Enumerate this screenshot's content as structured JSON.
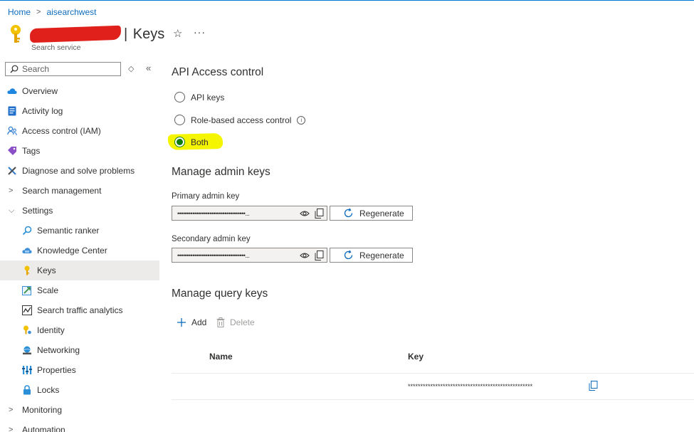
{
  "breadcrumb": {
    "home": "Home",
    "resource": "aisearchwest"
  },
  "header": {
    "title": "Keys",
    "subtitle": "Search service"
  },
  "sidebar": {
    "search_placeholder": "Search",
    "items": [
      {
        "label": "Overview",
        "icon": "cloud-icon"
      },
      {
        "label": "Activity log",
        "icon": "log-icon"
      },
      {
        "label": "Access control (IAM)",
        "icon": "people-icon"
      },
      {
        "label": "Tags",
        "icon": "tag-icon"
      },
      {
        "label": "Diagnose and solve problems",
        "icon": "wrench-icon"
      },
      {
        "label": "Search management",
        "icon": "chevron-right-icon"
      },
      {
        "label": "Settings",
        "icon": "chevron-down-icon"
      },
      {
        "label": "Semantic ranker",
        "icon": "search-icon"
      },
      {
        "label": "Knowledge Center",
        "icon": "cloud-icon"
      },
      {
        "label": "Keys",
        "icon": "key-icon"
      },
      {
        "label": "Scale",
        "icon": "scale-icon"
      },
      {
        "label": "Search traffic analytics",
        "icon": "chart-icon"
      },
      {
        "label": "Identity",
        "icon": "identity-icon"
      },
      {
        "label": "Networking",
        "icon": "network-icon"
      },
      {
        "label": "Properties",
        "icon": "properties-icon"
      },
      {
        "label": "Locks",
        "icon": "lock-icon"
      },
      {
        "label": "Monitoring",
        "icon": "chevron-right-icon"
      },
      {
        "label": "Automation",
        "icon": "chevron-right-icon"
      }
    ]
  },
  "access": {
    "heading": "API Access control",
    "options": [
      "API keys",
      "Role-based access control",
      "Both"
    ],
    "selected": "Both"
  },
  "admin": {
    "heading": "Manage admin keys",
    "primary_label": "Primary admin key",
    "secondary_label": "Secondary admin key",
    "masked_value": "••••••••••••••••••••••••••••••••••••...",
    "regenerate_label": "Regenerate"
  },
  "query": {
    "heading": "Manage query keys",
    "add_label": "Add",
    "delete_label": "Delete",
    "columns": {
      "name": "Name",
      "key": "Key"
    },
    "rows": [
      {
        "name": "",
        "key": "**************************************************"
      }
    ]
  },
  "colors": {
    "accent": "#0078d4",
    "radio_selected": "#107c10",
    "highlight": "#f5f500",
    "redaction": "#e0201b"
  }
}
